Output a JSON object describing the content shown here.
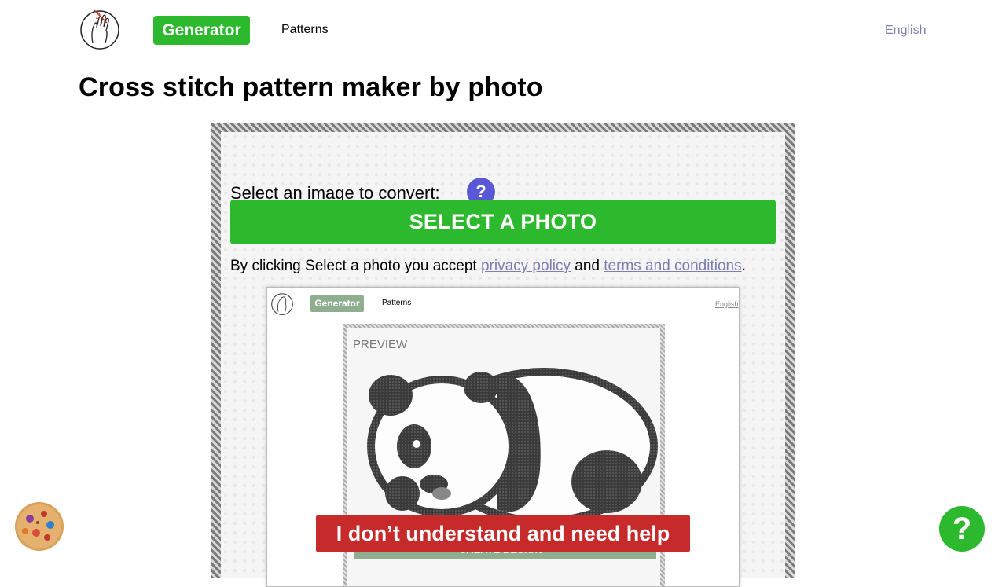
{
  "header": {
    "nav_generator": "Generator",
    "nav_patterns": "Patterns",
    "language": "English",
    "logo_icon": "hand-needle-logo"
  },
  "page": {
    "title": "Cross stitch pattern maker by photo"
  },
  "converter": {
    "select_label": "Select an image to convert:",
    "help_symbol": "?",
    "select_button": "SELECT A PHOTO",
    "consent_prefix": "By clicking Select a photo you accept",
    "privacy_link": "privacy policy",
    "consent_and": "and",
    "terms_link": "terms and conditions",
    "consent_suffix": "."
  },
  "preview_screenshot": {
    "nav_generator": "Generator",
    "nav_patterns": "Patterns",
    "language": "English",
    "preview_label": "PREVIEW",
    "create_button": "CREATE DESIGN >",
    "image_icon": "panda-cross-stitch"
  },
  "help_banner": "I don’t understand and need help",
  "float_help": "?",
  "cookie_icon": "cookie-icon",
  "colors": {
    "primary_green": "#2db92d",
    "help_purple": "#5a57d6",
    "banner_red": "#c62a2a",
    "link": "#7a7fb0"
  }
}
